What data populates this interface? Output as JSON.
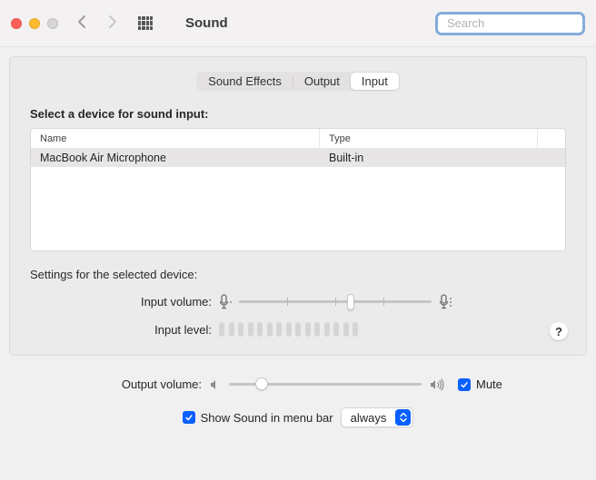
{
  "window": {
    "title": "Sound"
  },
  "search": {
    "placeholder": "Search",
    "value": ""
  },
  "tabs": {
    "items": [
      "Sound Effects",
      "Output",
      "Input"
    ],
    "active": 2
  },
  "device_section": {
    "title": "Select a device for sound input:",
    "columns": {
      "name": "Name",
      "type": "Type"
    },
    "rows": [
      {
        "name": "MacBook Air Microphone",
        "type": "Built-in"
      }
    ]
  },
  "selected_settings": {
    "title": "Settings for the selected device:",
    "input_volume_label": "Input volume:",
    "input_volume_percent": 58,
    "input_level_label": "Input level:",
    "input_level_segments": 15,
    "input_level_lit": 0
  },
  "footer": {
    "output_volume_label": "Output volume:",
    "output_volume_percent": 17,
    "mute_label": "Mute",
    "mute_checked": true,
    "menubar_label": "Show Sound in menu bar",
    "menubar_checked": true,
    "menubar_mode": "always"
  },
  "help": {
    "symbol": "?"
  }
}
